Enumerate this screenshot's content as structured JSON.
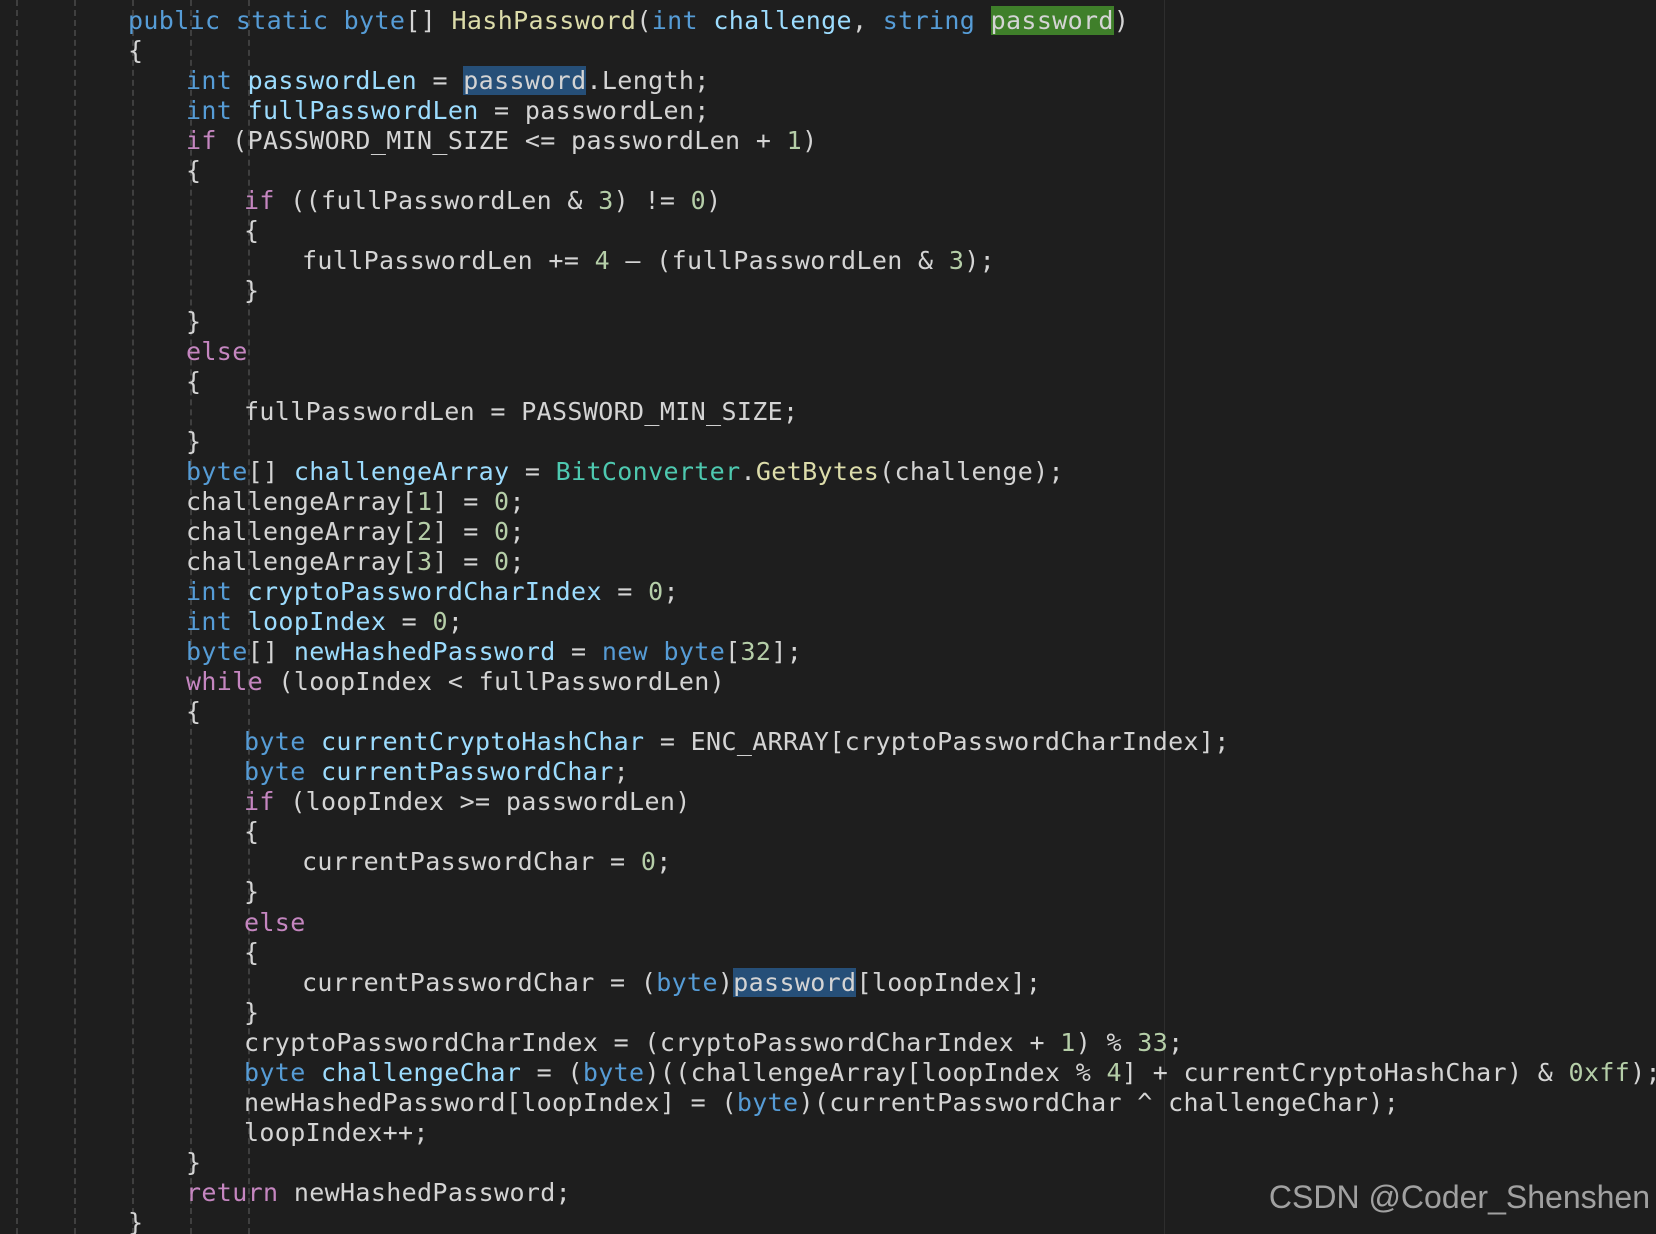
{
  "theme": {
    "background": "#1e1e1e",
    "token_colors": {
      "kw": "#569cd6",
      "ctrl": "#c586c0",
      "fn": "#dcdcaa",
      "var": "#9cdcfe",
      "num": "#b5cea8",
      "type": "#4ec9b0",
      "plain": "#d4d4d4",
      "hl": "#264f78",
      "hlg": "#3f7f2a"
    }
  },
  "editor": {
    "lines": [
      {
        "indent": 0,
        "tokens": [
          [
            "kw",
            "public"
          ],
          [
            "plain",
            " "
          ],
          [
            "kw",
            "static"
          ],
          [
            "plain",
            " "
          ],
          [
            "kw",
            "byte"
          ],
          [
            "plain",
            "[] "
          ],
          [
            "fn",
            "HashPassword"
          ],
          [
            "plain",
            "("
          ],
          [
            "kw",
            "int"
          ],
          [
            "plain",
            " "
          ],
          [
            "var",
            "challenge"
          ],
          [
            "plain",
            ", "
          ],
          [
            "kw",
            "string"
          ],
          [
            "plain",
            " "
          ],
          [
            "hlg",
            "password"
          ],
          [
            "plain",
            ")"
          ]
        ]
      },
      {
        "indent": 0,
        "tokens": [
          [
            "plain",
            "{"
          ]
        ]
      },
      {
        "indent": 1,
        "tokens": [
          [
            "kw",
            "int"
          ],
          [
            "plain",
            " "
          ],
          [
            "var",
            "passwordLen"
          ],
          [
            "plain",
            " = "
          ],
          [
            "hl",
            "password"
          ],
          [
            "plain",
            ".Length;"
          ]
        ]
      },
      {
        "indent": 1,
        "tokens": [
          [
            "kw",
            "int"
          ],
          [
            "plain",
            " "
          ],
          [
            "var",
            "fullPasswordLen"
          ],
          [
            "plain",
            " = passwordLen;"
          ]
        ]
      },
      {
        "indent": 1,
        "tokens": [
          [
            "ctrl",
            "if"
          ],
          [
            "plain",
            " (PASSWORD_MIN_SIZE <= passwordLen + "
          ],
          [
            "num",
            "1"
          ],
          [
            "plain",
            ")"
          ]
        ]
      },
      {
        "indent": 1,
        "tokens": [
          [
            "plain",
            "{"
          ]
        ]
      },
      {
        "indent": 2,
        "tokens": [
          [
            "ctrl",
            "if"
          ],
          [
            "plain",
            " ((fullPasswordLen & "
          ],
          [
            "num",
            "3"
          ],
          [
            "plain",
            ") != "
          ],
          [
            "num",
            "0"
          ],
          [
            "plain",
            ")"
          ]
        ]
      },
      {
        "indent": 2,
        "tokens": [
          [
            "plain",
            "{"
          ]
        ]
      },
      {
        "indent": 3,
        "tokens": [
          [
            "plain",
            "fullPasswordLen += "
          ],
          [
            "num",
            "4"
          ],
          [
            "plain",
            " – (fullPasswordLen & "
          ],
          [
            "num",
            "3"
          ],
          [
            "plain",
            ");"
          ]
        ]
      },
      {
        "indent": 2,
        "tokens": [
          [
            "plain",
            "}"
          ]
        ]
      },
      {
        "indent": 1,
        "tokens": [
          [
            "plain",
            "}"
          ]
        ]
      },
      {
        "indent": 1,
        "tokens": [
          [
            "ctrl",
            "else"
          ]
        ]
      },
      {
        "indent": 1,
        "tokens": [
          [
            "plain",
            "{"
          ]
        ]
      },
      {
        "indent": 2,
        "tokens": [
          [
            "plain",
            "fullPasswordLen = PASSWORD_MIN_SIZE;"
          ]
        ]
      },
      {
        "indent": 1,
        "tokens": [
          [
            "plain",
            "}"
          ]
        ]
      },
      {
        "indent": 1,
        "tokens": [
          [
            "kw",
            "byte"
          ],
          [
            "plain",
            "[] "
          ],
          [
            "var",
            "challengeArray"
          ],
          [
            "plain",
            " = "
          ],
          [
            "type",
            "BitConverter"
          ],
          [
            "plain",
            "."
          ],
          [
            "fn",
            "GetBytes"
          ],
          [
            "plain",
            "(challenge);"
          ]
        ]
      },
      {
        "indent": 1,
        "tokens": [
          [
            "plain",
            "challengeArray["
          ],
          [
            "num",
            "1"
          ],
          [
            "plain",
            "] = "
          ],
          [
            "num",
            "0"
          ],
          [
            "plain",
            ";"
          ]
        ]
      },
      {
        "indent": 1,
        "tokens": [
          [
            "plain",
            "challengeArray["
          ],
          [
            "num",
            "2"
          ],
          [
            "plain",
            "] = "
          ],
          [
            "num",
            "0"
          ],
          [
            "plain",
            ";"
          ]
        ]
      },
      {
        "indent": 1,
        "tokens": [
          [
            "plain",
            "challengeArray["
          ],
          [
            "num",
            "3"
          ],
          [
            "plain",
            "] = "
          ],
          [
            "num",
            "0"
          ],
          [
            "plain",
            ";"
          ]
        ]
      },
      {
        "indent": 1,
        "tokens": [
          [
            "kw",
            "int"
          ],
          [
            "plain",
            " "
          ],
          [
            "var",
            "cryptoPasswordCharIndex"
          ],
          [
            "plain",
            " = "
          ],
          [
            "num",
            "0"
          ],
          [
            "plain",
            ";"
          ]
        ]
      },
      {
        "indent": 1,
        "tokens": [
          [
            "kw",
            "int"
          ],
          [
            "plain",
            " "
          ],
          [
            "var",
            "loopIndex"
          ],
          [
            "plain",
            " = "
          ],
          [
            "num",
            "0"
          ],
          [
            "plain",
            ";"
          ]
        ]
      },
      {
        "indent": 1,
        "tokens": [
          [
            "kw",
            "byte"
          ],
          [
            "plain",
            "[] "
          ],
          [
            "var",
            "newHashedPassword"
          ],
          [
            "plain",
            " = "
          ],
          [
            "kw",
            "new"
          ],
          [
            "plain",
            " "
          ],
          [
            "kw",
            "byte"
          ],
          [
            "plain",
            "["
          ],
          [
            "num",
            "32"
          ],
          [
            "plain",
            "];"
          ]
        ]
      },
      {
        "indent": 1,
        "tokens": [
          [
            "ctrl",
            "while"
          ],
          [
            "plain",
            " (loopIndex < fullPasswordLen)"
          ]
        ]
      },
      {
        "indent": 1,
        "tokens": [
          [
            "plain",
            "{"
          ]
        ]
      },
      {
        "indent": 2,
        "tokens": [
          [
            "kw",
            "byte"
          ],
          [
            "plain",
            " "
          ],
          [
            "var",
            "currentCryptoHashChar"
          ],
          [
            "plain",
            " = ENC_ARRAY[cryptoPasswordCharIndex];"
          ]
        ]
      },
      {
        "indent": 2,
        "tokens": [
          [
            "kw",
            "byte"
          ],
          [
            "plain",
            " "
          ],
          [
            "var",
            "currentPasswordChar"
          ],
          [
            "plain",
            ";"
          ]
        ]
      },
      {
        "indent": 2,
        "tokens": [
          [
            "ctrl",
            "if"
          ],
          [
            "plain",
            " (loopIndex >= passwordLen)"
          ]
        ]
      },
      {
        "indent": 2,
        "tokens": [
          [
            "plain",
            "{"
          ]
        ]
      },
      {
        "indent": 3,
        "tokens": [
          [
            "plain",
            "currentPasswordChar = "
          ],
          [
            "num",
            "0"
          ],
          [
            "plain",
            ";"
          ]
        ]
      },
      {
        "indent": 2,
        "tokens": [
          [
            "plain",
            "}"
          ]
        ]
      },
      {
        "indent": 2,
        "tokens": [
          [
            "ctrl",
            "else"
          ]
        ]
      },
      {
        "indent": 2,
        "tokens": [
          [
            "plain",
            "{"
          ]
        ]
      },
      {
        "indent": 3,
        "tokens": [
          [
            "plain",
            "currentPasswordChar = ("
          ],
          [
            "kw",
            "byte"
          ],
          [
            "plain",
            ")"
          ],
          [
            "hl",
            "password"
          ],
          [
            "plain",
            "[loopIndex];"
          ]
        ]
      },
      {
        "indent": 2,
        "tokens": [
          [
            "plain",
            "}"
          ]
        ]
      },
      {
        "indent": 2,
        "tokens": [
          [
            "plain",
            "cryptoPasswordCharIndex = (cryptoPasswordCharIndex + "
          ],
          [
            "num",
            "1"
          ],
          [
            "plain",
            ") % "
          ],
          [
            "num",
            "33"
          ],
          [
            "plain",
            ";"
          ]
        ]
      },
      {
        "indent": 2,
        "tokens": [
          [
            "kw",
            "byte"
          ],
          [
            "plain",
            " "
          ],
          [
            "var",
            "challengeChar"
          ],
          [
            "plain",
            " = ("
          ],
          [
            "kw",
            "byte"
          ],
          [
            "plain",
            ")((challengeArray[loopIndex % "
          ],
          [
            "num",
            "4"
          ],
          [
            "plain",
            "] + currentCryptoHashChar) & "
          ],
          [
            "num",
            "0xff"
          ],
          [
            "plain",
            ");"
          ]
        ]
      },
      {
        "indent": 2,
        "tokens": [
          [
            "plain",
            "newHashedPassword[loopIndex] = ("
          ],
          [
            "kw",
            "byte"
          ],
          [
            "plain",
            ")(currentPasswordChar ^ challengeChar);"
          ]
        ]
      },
      {
        "indent": 2,
        "tokens": [
          [
            "plain",
            "loopIndex++;"
          ]
        ]
      },
      {
        "indent": 1,
        "tokens": [
          [
            "plain",
            "}"
          ]
        ]
      },
      {
        "indent": 1,
        "tokens": [
          [
            "ctrl",
            "return"
          ],
          [
            "plain",
            " newHashedPassword;"
          ]
        ]
      },
      {
        "indent": 0,
        "tokens": [
          [
            "plain",
            "}"
          ]
        ]
      }
    ]
  },
  "watermark": "CSDN @Coder_Shenshen"
}
